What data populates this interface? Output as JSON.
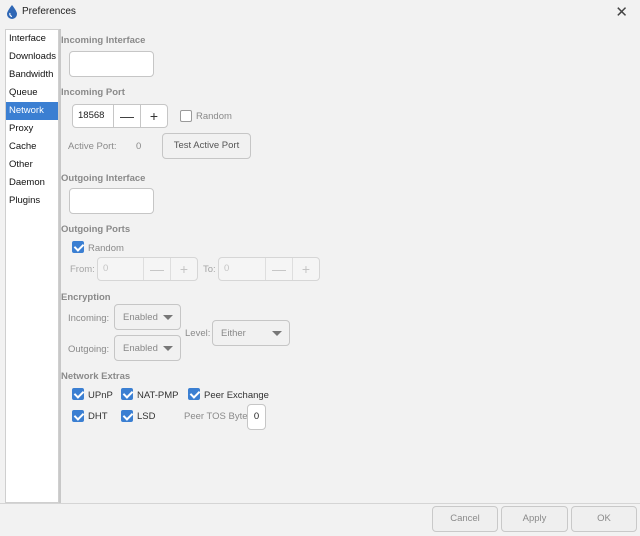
{
  "window": {
    "title": "Preferences"
  },
  "sidebar": {
    "items": [
      {
        "label": "Interface"
      },
      {
        "label": "Downloads"
      },
      {
        "label": "Bandwidth"
      },
      {
        "label": "Queue"
      },
      {
        "label": "Network",
        "selected": true
      },
      {
        "label": "Proxy"
      },
      {
        "label": "Cache"
      },
      {
        "label": "Other"
      },
      {
        "label": "Daemon"
      },
      {
        "label": "Plugins"
      }
    ]
  },
  "incoming_interface": {
    "title": "Incoming Interface",
    "value": ""
  },
  "incoming_port": {
    "title": "Incoming Port",
    "value": "18568",
    "random_label": "Random",
    "random_checked": false,
    "active_port_label": "Active Port:",
    "active_port_value": "0",
    "test_button": "Test Active Port"
  },
  "outgoing_interface": {
    "title": "Outgoing Interface",
    "value": ""
  },
  "outgoing_ports": {
    "title": "Outgoing Ports",
    "random_label": "Random",
    "random_checked": true,
    "from_label": "From:",
    "from_value": "0",
    "to_label": "To:",
    "to_value": "0"
  },
  "encryption": {
    "title": "Encryption",
    "incoming_label": "Incoming:",
    "incoming_value": "Enabled",
    "outgoing_label": "Outgoing:",
    "outgoing_value": "Enabled",
    "level_label": "Level:",
    "level_value": "Either"
  },
  "network_extras": {
    "title": "Network Extras",
    "upnp": "UPnP",
    "natpmp": "NAT-PMP",
    "peer_exchange": "Peer Exchange",
    "dht": "DHT",
    "lsd": "LSD",
    "tos_label": "Peer TOS Byte:",
    "tos_value": "0"
  },
  "footer": {
    "cancel": "Cancel",
    "apply": "Apply",
    "ok": "OK"
  },
  "colors": {
    "accent": "#3b7fd2",
    "section_title": "#8a8a8a"
  },
  "icons": {
    "app": "water-drop-icon",
    "close": "close-icon",
    "minus": "minus-icon",
    "plus": "plus-icon",
    "dropdown": "chevron-down-icon"
  }
}
